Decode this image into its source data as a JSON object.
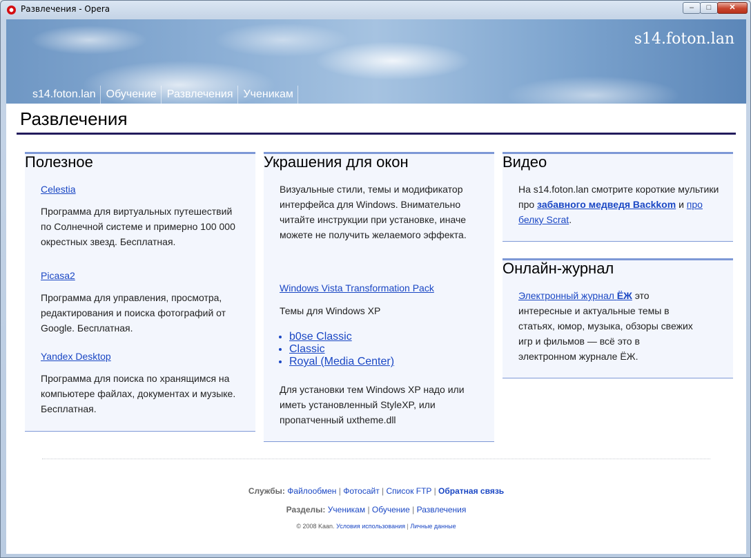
{
  "window": {
    "title": "Развлечения - Opera"
  },
  "header": {
    "site_logo": "s14.foton.lan",
    "nav": [
      "s14.foton.lan",
      "Обучение",
      "Развлечения",
      "Ученикам"
    ]
  },
  "page": {
    "title": "Развлечения"
  },
  "col1": {
    "heading": "Полезное",
    "items": [
      {
        "link": "Celestia",
        "text": "Программа для виртуальных путешествий по Солнечной системе и примерно 100 000 окрестных звезд. Бесплатная."
      },
      {
        "link": "Picasa2",
        "text": "Программа для управления, просмотра, редактирования и поиска фотографий от Google. Бесплатная."
      },
      {
        "link": "Yandex Desktop",
        "text": "Программа для поиска по хранящимся на компьютере файлах, документах и музыке. Бесплатная."
      }
    ]
  },
  "col2": {
    "heading": "Украшения для окон",
    "intro": "Визуальные стили, темы и модификатор интерфейса для Windows. Внимательно читайте инструкции при установке, иначе можете не получить желаемого эффекта.",
    "link": "Windows Vista Transformation Pack",
    "xp_label": "Темы для Windows XP",
    "themes": [
      "b0se Classic",
      "Classic",
      "Royal (Media Center)"
    ],
    "note": "Для установки тем Windows XP надо или иметь установленный StyleXP, или пропатченный uxtheme.dll"
  },
  "col3": {
    "video_heading": "Видео",
    "video_prefix": "На s14.foton.lan смотрите короткие мультики про",
    "video_link1": "забавного медведя Backkom",
    "video_and": "и",
    "video_link2": "про белку Scrat",
    "video_end": ".",
    "journal_heading": "Онлайн-журнал",
    "journal_link_prefix": "Электронный журнал",
    "journal_link_bold": "ЁЖ",
    "journal_text": "это интересные и актуальные темы в статьях, юмор, музыка, обзоры свежих игр и фильмов — всё это в электронном журнале ЁЖ."
  },
  "footer": {
    "services_label": "Службы:",
    "services": [
      "Файлообмен",
      "Фотосайт",
      "Список FTP",
      "Обратная связь"
    ],
    "sections_label": "Разделы:",
    "sections": [
      "Ученикам",
      "Обучение",
      "Развлечения"
    ],
    "copyright": "© 2008 Kaan.",
    "terms": "Условия использования",
    "privacy": "Личные данные",
    "separator": "|"
  }
}
